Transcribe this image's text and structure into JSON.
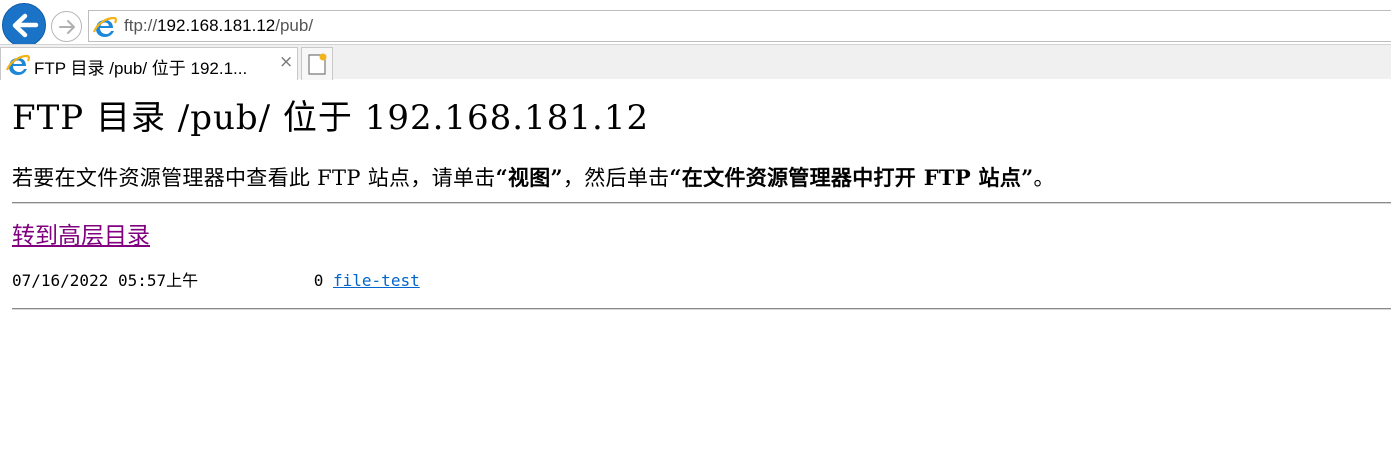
{
  "browser": {
    "address": {
      "scheme": "ftp://",
      "host": "192.168.181.12",
      "path": "/pub/"
    },
    "tab": {
      "title": "FTP 目录 /pub/ 位于 192.1...",
      "close_glyph": "×"
    }
  },
  "page": {
    "title": "FTP 目录 /pub/ 位于 192.168.181.12",
    "instructions": {
      "part1": "若要在文件资源管理器中查看此 FTP 站点，请单击",
      "bold1": "“视图”",
      "part2": "，然后单击",
      "bold2": "“在文件资源管理器中打开 FTP 站点”",
      "part3": "。"
    },
    "parent_link": "转到高层目录",
    "listing": [
      {
        "date": "07/16/2022",
        "time": "05:57上午",
        "size": "0",
        "name": "file-test"
      }
    ]
  },
  "colors": {
    "back_button": "#1a73c6",
    "visited_link": "#800080",
    "file_link": "#0066cc"
  },
  "icons": [
    "back-arrow-icon",
    "forward-arrow-icon",
    "ie-logo-icon",
    "new-tab-icon",
    "close-icon"
  ]
}
